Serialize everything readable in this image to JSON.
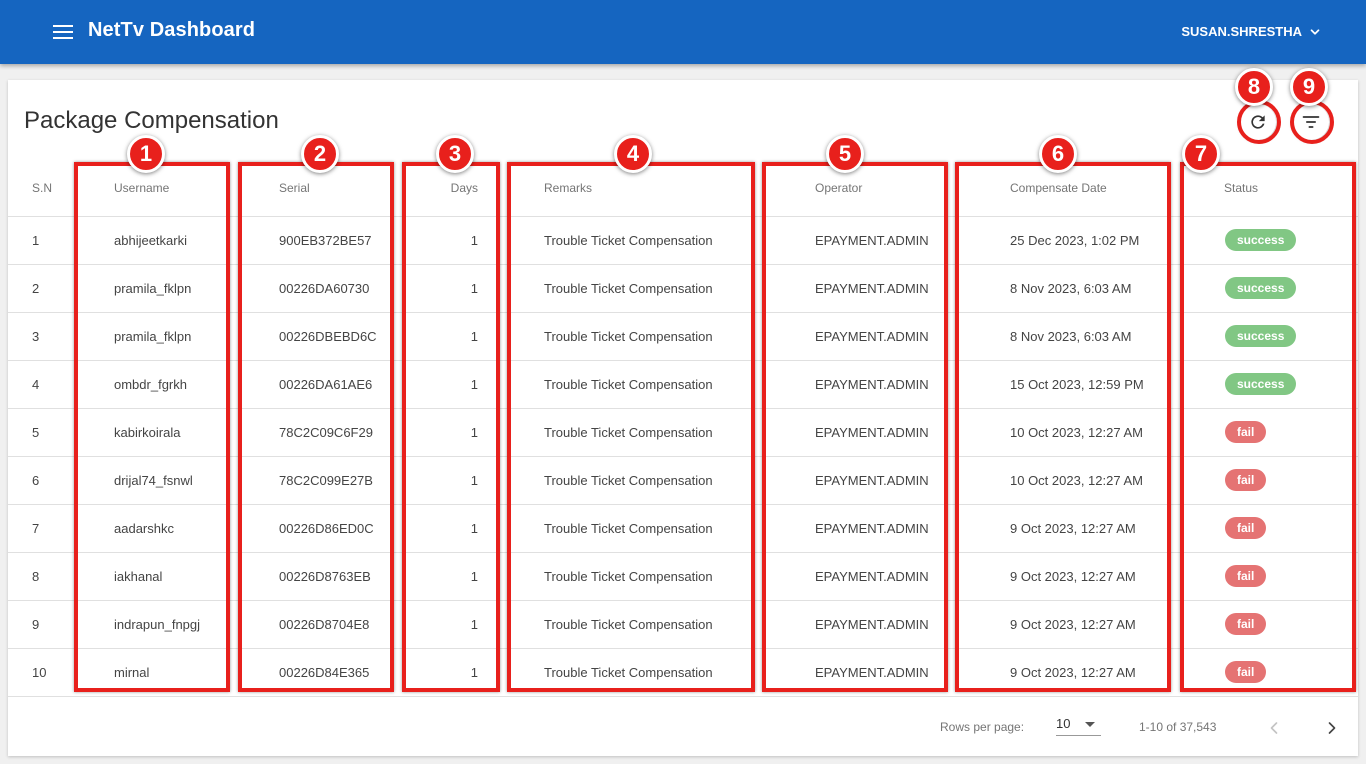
{
  "appbar": {
    "title": "NetTv Dashboard",
    "user": "SUSAN.SHRESTHA",
    "menu_icon": "hamburger-menu-icon",
    "user_icon": "chevron-down-icon"
  },
  "page": {
    "title": "Package Compensation",
    "refresh_icon": "refresh-icon",
    "filter_icon": "filter-icon"
  },
  "table": {
    "headers": {
      "sn": "S.N",
      "username": "Username",
      "serial": "Serial",
      "days": "Days",
      "remarks": "Remarks",
      "operator": "Operator",
      "date": "Compensate Date",
      "status": "Status"
    },
    "rows": [
      {
        "sn": "1",
        "username": "abhijeetkarki",
        "serial": "900EB372BE57",
        "days": "1",
        "remarks": "Trouble Ticket Compensation",
        "operator": "EPAYMENT.ADMIN",
        "date": "25 Dec 2023, 1:02 PM",
        "status": "success"
      },
      {
        "sn": "2",
        "username": "pramila_fklpn",
        "serial": "00226DA60730",
        "days": "1",
        "remarks": "Trouble Ticket Compensation",
        "operator": "EPAYMENT.ADMIN",
        "date": "8 Nov 2023, 6:03 AM",
        "status": "success"
      },
      {
        "sn": "3",
        "username": "pramila_fklpn",
        "serial": "00226DBEBD6C",
        "days": "1",
        "remarks": "Trouble Ticket Compensation",
        "operator": "EPAYMENT.ADMIN",
        "date": "8 Nov 2023, 6:03 AM",
        "status": "success"
      },
      {
        "sn": "4",
        "username": "ombdr_fgrkh",
        "serial": "00226DA61AE6",
        "days": "1",
        "remarks": "Trouble Ticket Compensation",
        "operator": "EPAYMENT.ADMIN",
        "date": "15 Oct 2023, 12:59 PM",
        "status": "success"
      },
      {
        "sn": "5",
        "username": "kabirkoirala",
        "serial": "78C2C09C6F29",
        "days": "1",
        "remarks": "Trouble Ticket Compensation",
        "operator": "EPAYMENT.ADMIN",
        "date": "10 Oct 2023, 12:27 AM",
        "status": "fail"
      },
      {
        "sn": "6",
        "username": "drijal74_fsnwl",
        "serial": "78C2C099E27B",
        "days": "1",
        "remarks": "Trouble Ticket Compensation",
        "operator": "EPAYMENT.ADMIN",
        "date": "10 Oct 2023, 12:27 AM",
        "status": "fail"
      },
      {
        "sn": "7",
        "username": "aadarshkc",
        "serial": "00226D86ED0C",
        "days": "1",
        "remarks": "Trouble Ticket Compensation",
        "operator": "EPAYMENT.ADMIN",
        "date": "9 Oct 2023, 12:27 AM",
        "status": "fail"
      },
      {
        "sn": "8",
        "username": "iakhanal",
        "serial": "00226D8763EB",
        "days": "1",
        "remarks": "Trouble Ticket Compensation",
        "operator": "EPAYMENT.ADMIN",
        "date": "9 Oct 2023, 12:27 AM",
        "status": "fail"
      },
      {
        "sn": "9",
        "username": "indrapun_fnpgj",
        "serial": "00226D8704E8",
        "days": "1",
        "remarks": "Trouble Ticket Compensation",
        "operator": "EPAYMENT.ADMIN",
        "date": "9 Oct 2023, 12:27 AM",
        "status": "fail"
      },
      {
        "sn": "10",
        "username": "mirnal",
        "serial": "00226D84E365",
        "days": "1",
        "remarks": "Trouble Ticket Compensation",
        "operator": "EPAYMENT.ADMIN",
        "date": "9 Oct 2023, 12:27 AM",
        "status": "fail"
      }
    ]
  },
  "pagination": {
    "rows_label": "Rows per page:",
    "rows_value": "10",
    "range": "1-10 of 37,543",
    "prev_icon": "chevron-left-icon",
    "next_icon": "chevron-right-icon"
  },
  "annotations": {
    "labels": [
      "1",
      "2",
      "3",
      "4",
      "5",
      "6",
      "7",
      "8",
      "9"
    ],
    "color": "#e8201c"
  },
  "colors": {
    "appbar": "#1565c0",
    "success": "#81c784",
    "fail": "#e57373"
  }
}
